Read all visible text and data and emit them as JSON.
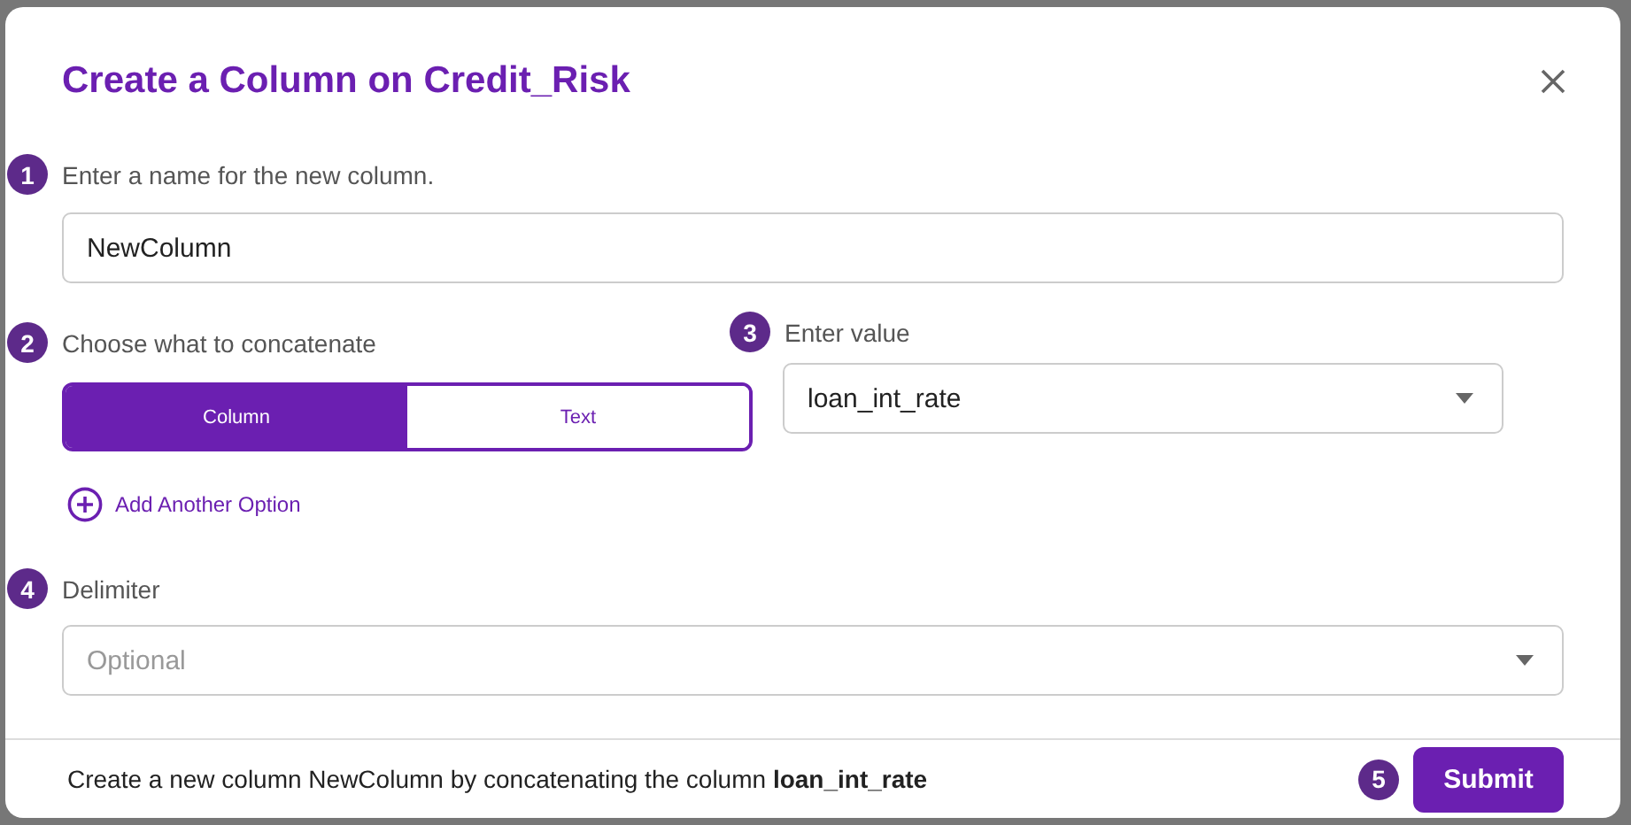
{
  "dialog": {
    "title": "Create a Column on Credit_Risk"
  },
  "name_field": {
    "step": "1",
    "label": "Enter a name for the new column.",
    "value": "NewColumn"
  },
  "concat": {
    "step": "2",
    "label": "Choose what to concatenate",
    "options": [
      {
        "label": "Column",
        "selected": true
      },
      {
        "label": "Text",
        "selected": false
      }
    ]
  },
  "value_field": {
    "step": "3",
    "label": "Enter value",
    "value": "loan_int_rate"
  },
  "add_option": {
    "label": "Add Another Option"
  },
  "delimiter": {
    "step": "4",
    "label": "Delimiter",
    "placeholder": "Optional"
  },
  "footer": {
    "summary": "Create a new column NewColumn by concatenating the column **loan_int_rate**",
    "submit_step": "5",
    "submit": "Submit"
  }
}
